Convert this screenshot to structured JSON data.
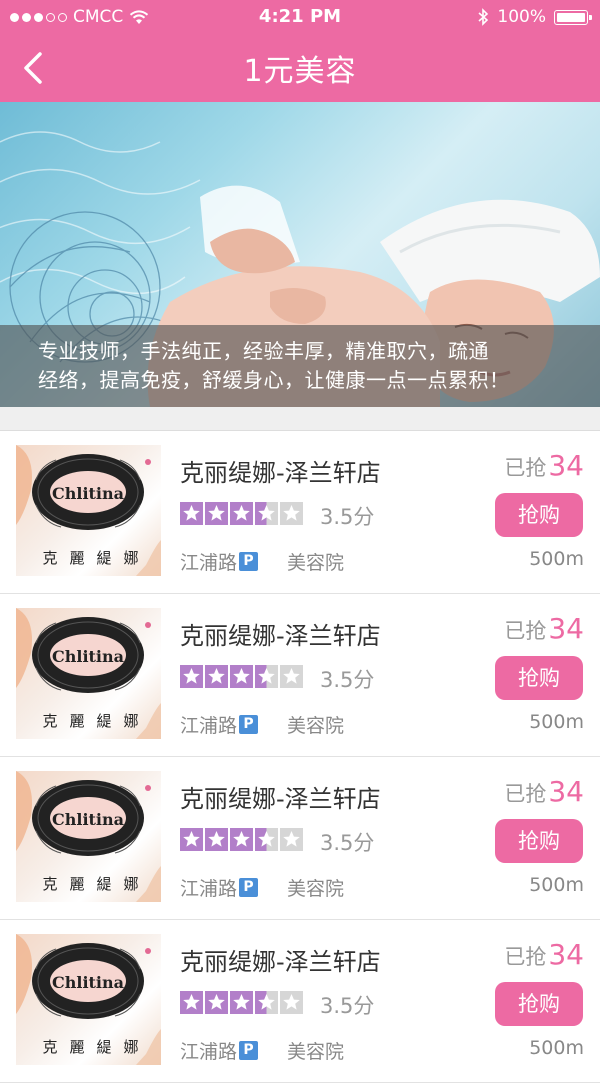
{
  "status_bar": {
    "carrier": "CMCC",
    "time": "4:21 PM",
    "battery": "100%"
  },
  "nav": {
    "title": "1元美容"
  },
  "banner": {
    "caption_line1": "专业技师，手法纯正，经验丰厚，精准取穴，疏通",
    "caption_line2": "经络，提高免疫，舒缓身心，让健康一点一点累积！"
  },
  "colors": {
    "accent": "#ed6aa3",
    "star_filled": "#b27fc9",
    "star_empty": "#d6d6d6",
    "parking_badge": "#4a8fd8"
  },
  "list": {
    "items": [
      {
        "name": "克丽缇娜-泽兰轩店",
        "rating": 3.5,
        "score_text": "3.5分",
        "street": "江浦路",
        "parking": "P",
        "category": "美容院",
        "sold_label": "已抢",
        "sold_count": "34",
        "button": "抢购",
        "distance": "500m",
        "logo_text": "Chlitina",
        "logo_cn": [
          "克",
          "麗",
          "緹",
          "娜"
        ]
      },
      {
        "name": "克丽缇娜-泽兰轩店",
        "rating": 3.5,
        "score_text": "3.5分",
        "street": "江浦路",
        "parking": "P",
        "category": "美容院",
        "sold_label": "已抢",
        "sold_count": "34",
        "button": "抢购",
        "distance": "500m",
        "logo_text": "Chlitina",
        "logo_cn": [
          "克",
          "麗",
          "緹",
          "娜"
        ]
      },
      {
        "name": "克丽缇娜-泽兰轩店",
        "rating": 3.5,
        "score_text": "3.5分",
        "street": "江浦路",
        "parking": "P",
        "category": "美容院",
        "sold_label": "已抢",
        "sold_count": "34",
        "button": "抢购",
        "distance": "500m",
        "logo_text": "Chlitina",
        "logo_cn": [
          "克",
          "麗",
          "緹",
          "娜"
        ]
      },
      {
        "name": "克丽缇娜-泽兰轩店",
        "rating": 3.5,
        "score_text": "3.5分",
        "street": "江浦路",
        "parking": "P",
        "category": "美容院",
        "sold_label": "已抢",
        "sold_count": "34",
        "button": "抢购",
        "distance": "500m",
        "logo_text": "Chlitina",
        "logo_cn": [
          "克",
          "麗",
          "緹",
          "娜"
        ]
      }
    ]
  }
}
